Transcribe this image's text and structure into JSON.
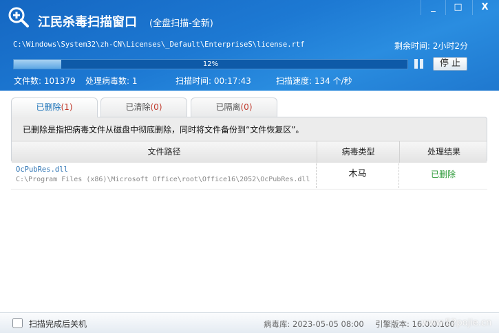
{
  "window": {
    "title": "江民杀毒扫描窗口",
    "subtitle": "(全盘扫描-全新)",
    "minimize": "_",
    "maximize": "□",
    "close": "X"
  },
  "scan": {
    "current_file": "C:\\Windows\\System32\\zh-CN\\Licenses\\_Default\\EnterpriseS\\license.rtf",
    "remaining": "剩余时间: 2小时2分",
    "progress_percent": 12,
    "progress_label": "12%",
    "stop_label": "停 止",
    "files": "文件数: 101379",
    "handled": "处理病毒数: 1",
    "time": "扫描时间: 00:17:43",
    "speed": "扫描速度: 134 个/秒"
  },
  "tabs": [
    {
      "label": "已删除",
      "count": "(1)"
    },
    {
      "label": "已清除",
      "count": "(0)"
    },
    {
      "label": "已隔离",
      "count": "(0)"
    }
  ],
  "description": "已删除是指把病毒文件从磁盘中彻底删除，同时将文件备份到“文件恢复区”。",
  "table": {
    "headers": [
      "文件路径",
      "病毒类型",
      "处理结果"
    ],
    "rows": [
      {
        "name": "OcPubRes.dll",
        "path": "C:\\Program Files (x86)\\Microsoft Office\\root\\Office16\\2052\\OcPubRes.dll",
        "type": "木马",
        "result": "已删除"
      }
    ]
  },
  "footer": {
    "shutdown_label": "扫描完成后关机",
    "db": "病毒库: 2023-05-05 08:00",
    "engine": "引擎版本: 16.0.0.100",
    "watermark": "www.52pojie.cn"
  }
}
